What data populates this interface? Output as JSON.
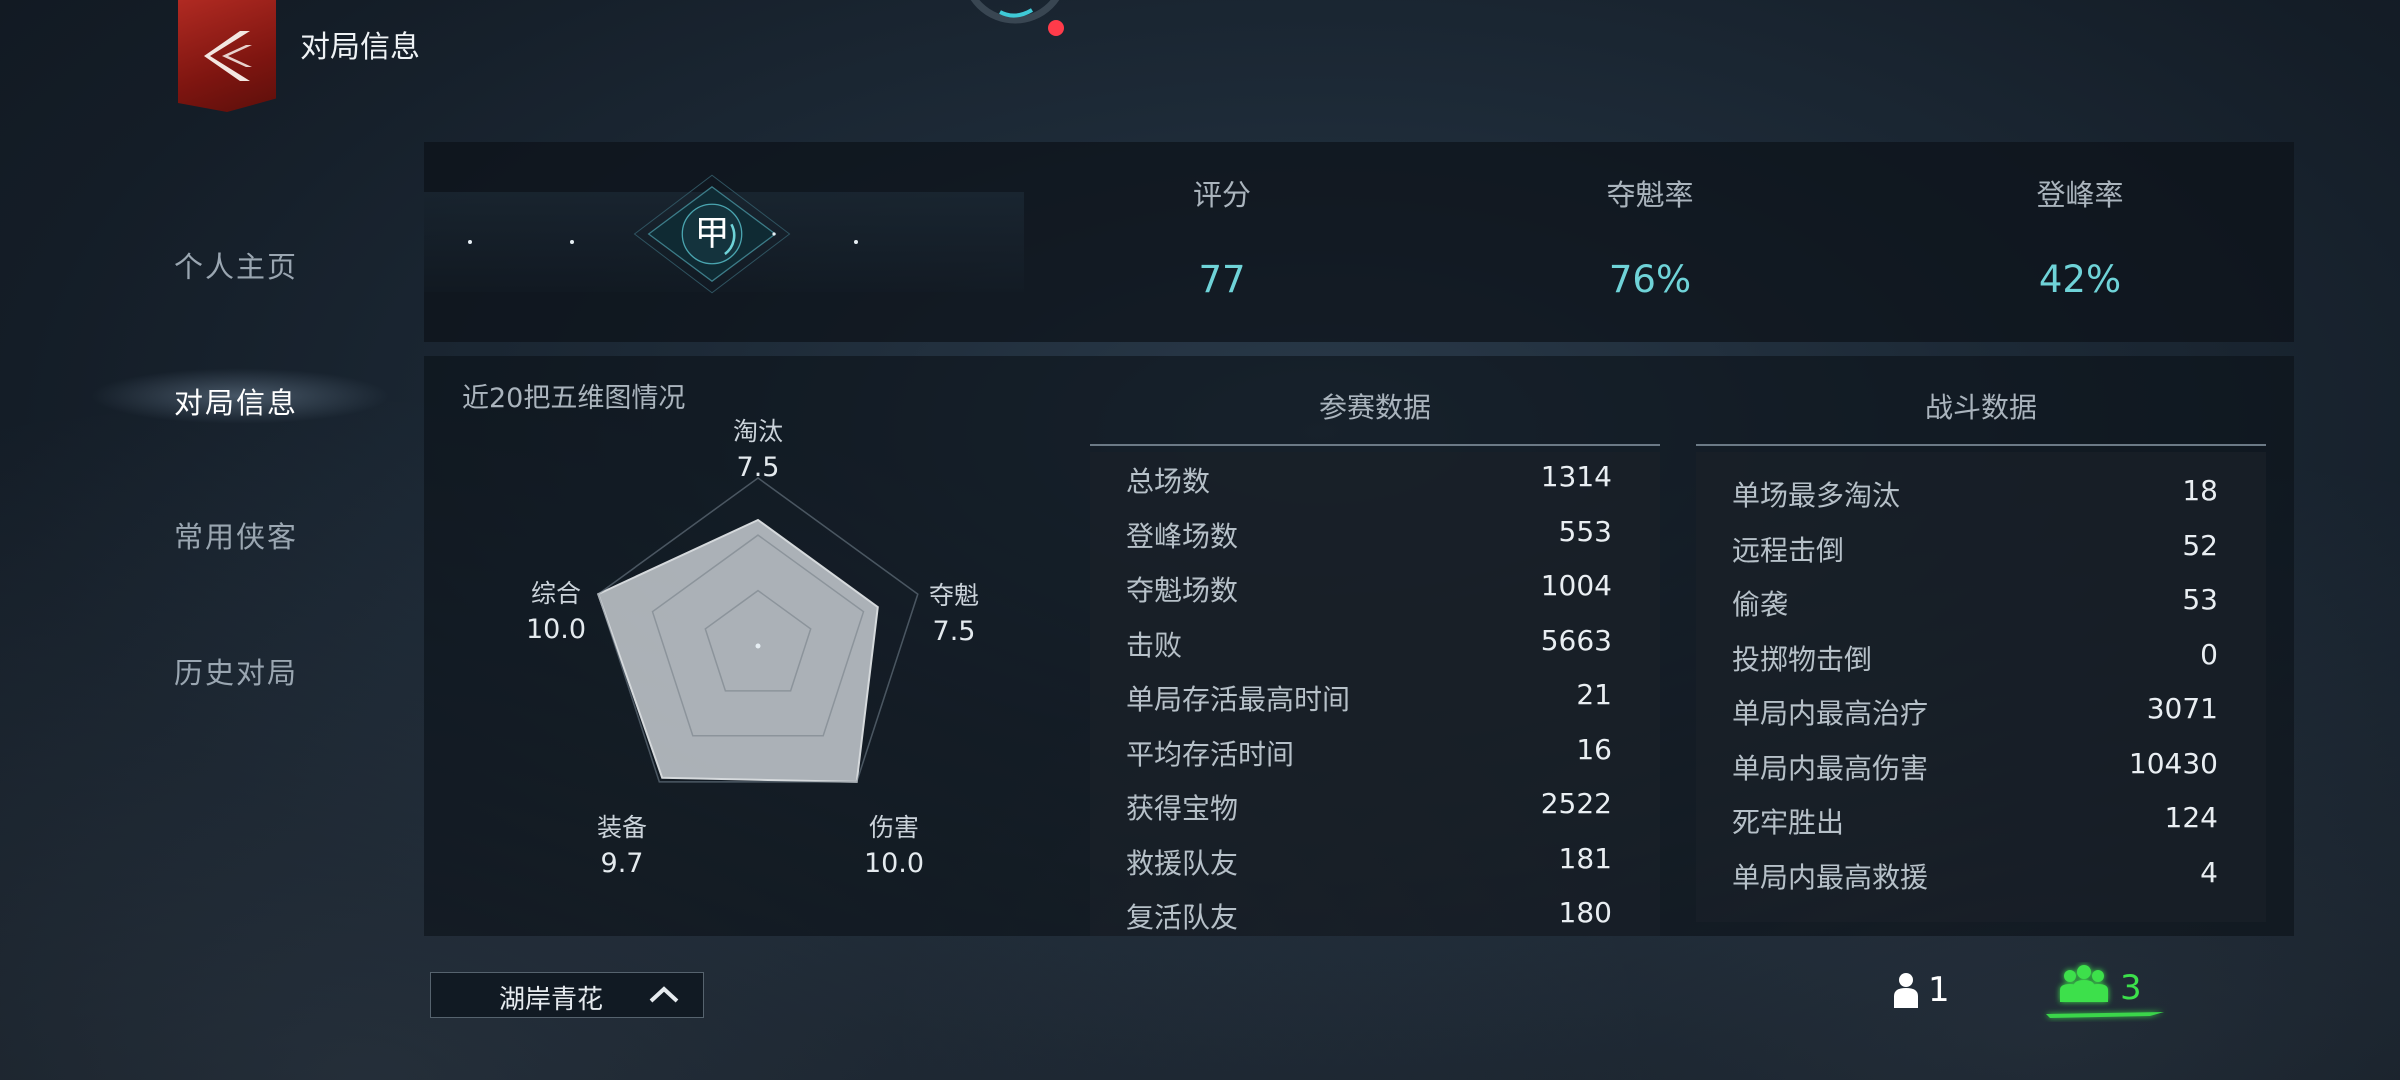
{
  "header": {
    "title": "对局信息",
    "logo_icon": "sword-chevron-icon"
  },
  "sidebar": {
    "items": [
      {
        "label": "个人主页",
        "active": false
      },
      {
        "label": "对局信息",
        "active": true
      },
      {
        "label": "常用侠客",
        "active": false
      },
      {
        "label": "历史对局",
        "active": false
      }
    ]
  },
  "rank": {
    "glyph": "甲"
  },
  "top_stats": [
    {
      "label": "评分",
      "value": "77"
    },
    {
      "label": "夺魁率",
      "value": "76%"
    },
    {
      "label": "登峰率",
      "value": "42%"
    }
  ],
  "radar": {
    "title": "近20把五维图情况",
    "axes": [
      {
        "name": "淘汰",
        "value": "7.5"
      },
      {
        "name": "夺魁",
        "value": "7.5"
      },
      {
        "name": "伤害",
        "value": "10.0"
      },
      {
        "name": "装备",
        "value": "9.7"
      },
      {
        "name": "综合",
        "value": "10.0"
      }
    ]
  },
  "chart_data": {
    "type": "radar",
    "title": "近20把五维图情况",
    "categories": [
      "淘汰",
      "夺魁",
      "伤害",
      "装备",
      "综合"
    ],
    "values": [
      7.5,
      7.5,
      10.0,
      9.7,
      10.0
    ],
    "range": [
      0,
      10
    ]
  },
  "participation": {
    "title": "参赛数据",
    "rows": [
      {
        "label": "总场数",
        "value": "1314"
      },
      {
        "label": "登峰场数",
        "value": "553"
      },
      {
        "label": "夺魁场数",
        "value": "1004"
      },
      {
        "label": "击败",
        "value": "5663"
      },
      {
        "label": "单局存活最高时间",
        "value": "21"
      },
      {
        "label": "平均存活时间",
        "value": "16"
      },
      {
        "label": "获得宝物",
        "value": "2522"
      },
      {
        "label": "救援队友",
        "value": "181"
      },
      {
        "label": "复活队友",
        "value": "180"
      }
    ]
  },
  "combat": {
    "title": "战斗数据",
    "rows": [
      {
        "label": "单场最多淘汰",
        "value": "18"
      },
      {
        "label": "远程击倒",
        "value": "52"
      },
      {
        "label": "偷袭",
        "value": "53"
      },
      {
        "label": "投掷物击倒",
        "value": "0"
      },
      {
        "label": "单局内最高治疗",
        "value": "3071"
      },
      {
        "label": "单局内最高伤害",
        "value": "10430"
      },
      {
        "label": "死牢胜出",
        "value": "124"
      },
      {
        "label": "单局内最高救援",
        "value": "4"
      }
    ]
  },
  "footer": {
    "season_selector": "湖岸青花",
    "solo_count": "1",
    "squad_count": "3"
  },
  "colors": {
    "accent": "#6fd3d8",
    "squad_active": "#3ce04b",
    "logo": "#b02a22"
  }
}
